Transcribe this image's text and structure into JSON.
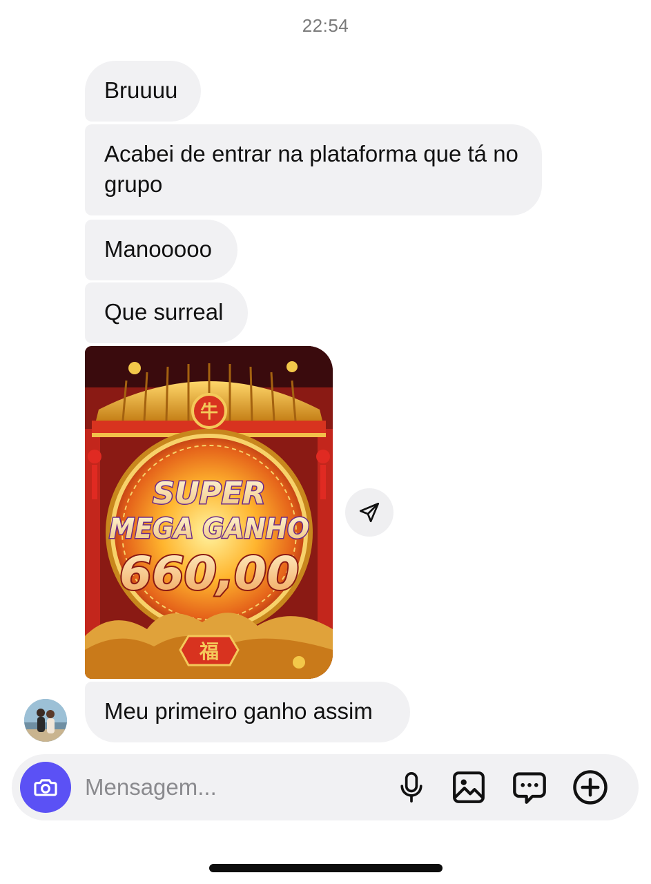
{
  "header": {
    "timestamp": "22:54"
  },
  "messages": [
    {
      "text": "Bruuuu"
    },
    {
      "text": "Acabei de entrar na plataforma que tá no grupo"
    },
    {
      "text": "Manooooo"
    },
    {
      "text": "Que surreal"
    },
    {
      "text": "Meu primeiro ganho assim"
    }
  ],
  "media": {
    "line1": "SUPER",
    "line2": "MEGA GANHO",
    "amount": "660,00",
    "emblem_top": "牛",
    "emblem_bottom": "福"
  },
  "composer": {
    "placeholder": "Mensagem..."
  },
  "icons": {
    "share": "paper-plane-icon",
    "camera": "camera-icon",
    "mic": "microphone-icon",
    "gallery": "image-icon",
    "sticker": "chat-bubble-icon",
    "plus": "plus-circle-icon"
  },
  "colors": {
    "bubble_bg": "#f1f1f3",
    "camera_accent": "#5b51f5",
    "timestamp": "#7a7a7a"
  }
}
